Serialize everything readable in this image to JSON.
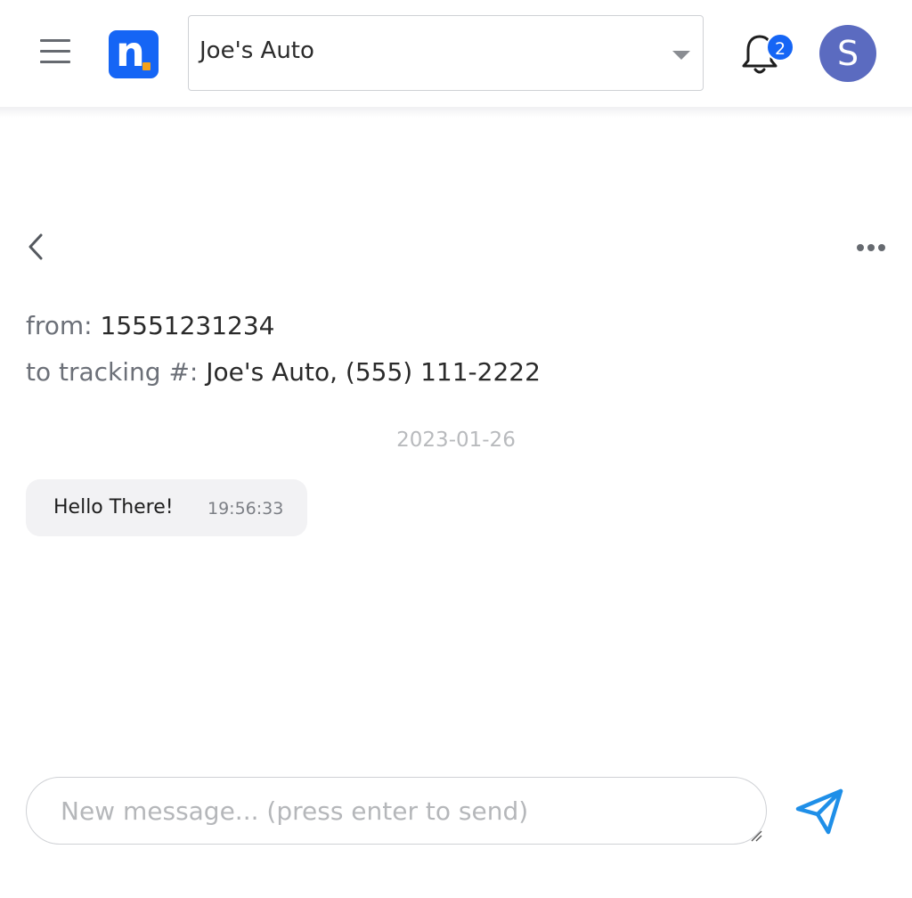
{
  "header": {
    "menu_icon": "hamburger-icon",
    "logo_letter": "n",
    "logo_color": "#1565f5",
    "logo_accent": "#f5a21a",
    "company_select": {
      "value": "Joe's Auto",
      "icon": "caret-down-icon"
    },
    "notifications": {
      "icon": "bell-icon",
      "count": "2",
      "badge_color": "#1565f5"
    },
    "avatar": {
      "initial": "S",
      "color": "#5b6bc0"
    }
  },
  "conversation": {
    "back_icon": "chevron-left-icon",
    "more_icon": "more-horizontal-icon",
    "from_label": "from:",
    "from_value": "15551231234",
    "to_label": "to tracking #:",
    "to_value": "Joe's Auto, (555) 111-2222",
    "date": "2023-01-26",
    "messages": [
      {
        "text": "Hello There!",
        "time": "19:56:33"
      }
    ]
  },
  "composer": {
    "placeholder": "New message... (press enter to send)",
    "value": "",
    "send_icon": "paper-plane-icon",
    "send_color": "#1f8fe8"
  }
}
